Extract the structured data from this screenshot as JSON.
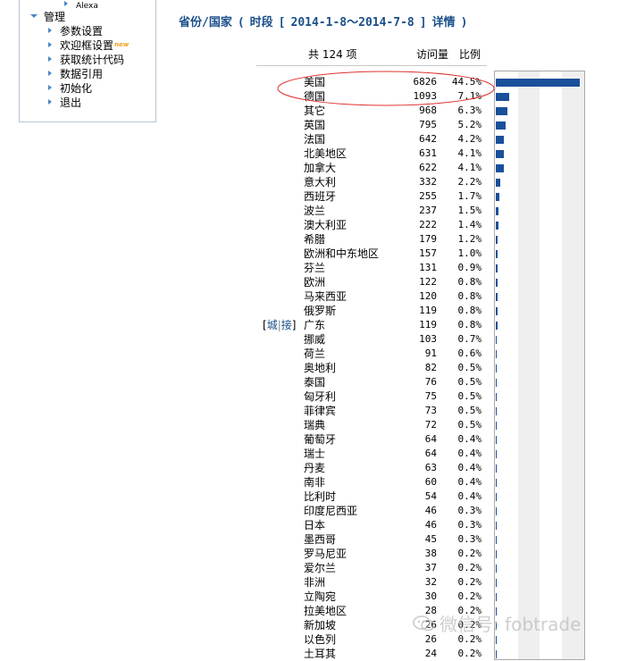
{
  "sidebar": {
    "items": [
      {
        "label": "Alexa",
        "icon": "arrow-right-icon"
      },
      {
        "label": "管理",
        "icon": "arrow-down-icon"
      },
      {
        "label": "参数设置",
        "icon": "arrow-right-icon"
      },
      {
        "label": "欢迎框设置",
        "icon": "arrow-right-icon",
        "badge": "new"
      },
      {
        "label": "获取统计代码",
        "icon": "arrow-right-icon"
      },
      {
        "label": "数据引用",
        "icon": "arrow-right-icon"
      },
      {
        "label": "初始化",
        "icon": "arrow-right-icon"
      },
      {
        "label": "退出",
        "icon": "arrow-right-icon"
      }
    ]
  },
  "title": {
    "prefix": "省份/国家",
    "open_paren": "(",
    "period_label": "时段",
    "open_bracket": "[",
    "date_range": "2014-1-8～2014-7-8",
    "close_bracket": "]",
    "details_link": "详情",
    "close_paren": ")"
  },
  "table": {
    "header": {
      "total": "共 124 项",
      "visits": "访问量",
      "ratio": "比例"
    },
    "city_link": "城",
    "separator": "|",
    "isp_link": "接",
    "rows": [
      {
        "name": "美国",
        "visits": "6826",
        "pct": "44.5%"
      },
      {
        "name": "德国",
        "visits": "1093",
        "pct": "7.1%"
      },
      {
        "name": "其它",
        "visits": "968",
        "pct": "6.3%"
      },
      {
        "name": "英国",
        "visits": "795",
        "pct": "5.2%"
      },
      {
        "name": "法国",
        "visits": "642",
        "pct": "4.2%"
      },
      {
        "name": "北美地区",
        "visits": "631",
        "pct": "4.1%"
      },
      {
        "name": "加拿大",
        "visits": "622",
        "pct": "4.1%"
      },
      {
        "name": "意大利",
        "visits": "332",
        "pct": "2.2%"
      },
      {
        "name": "西班牙",
        "visits": "255",
        "pct": "1.7%"
      },
      {
        "name": "波兰",
        "visits": "237",
        "pct": "1.5%"
      },
      {
        "name": "澳大利亚",
        "visits": "222",
        "pct": "1.4%"
      },
      {
        "name": "希腊",
        "visits": "179",
        "pct": "1.2%"
      },
      {
        "name": "欧洲和中东地区",
        "visits": "157",
        "pct": "1.0%"
      },
      {
        "name": "芬兰",
        "visits": "131",
        "pct": "0.9%"
      },
      {
        "name": "欧洲",
        "visits": "122",
        "pct": "0.8%"
      },
      {
        "name": "马来西亚",
        "visits": "120",
        "pct": "0.8%"
      },
      {
        "name": "俄罗斯",
        "visits": "119",
        "pct": "0.8%"
      },
      {
        "name": "广东",
        "visits": "119",
        "pct": "0.8%"
      },
      {
        "name": "挪威",
        "visits": "103",
        "pct": "0.7%"
      },
      {
        "name": "荷兰",
        "visits": "91",
        "pct": "0.6%"
      },
      {
        "name": "奥地利",
        "visits": "82",
        "pct": "0.5%"
      },
      {
        "name": "泰国",
        "visits": "76",
        "pct": "0.5%"
      },
      {
        "name": "匈牙利",
        "visits": "75",
        "pct": "0.5%"
      },
      {
        "name": "菲律宾",
        "visits": "73",
        "pct": "0.5%"
      },
      {
        "name": "瑞典",
        "visits": "72",
        "pct": "0.5%"
      },
      {
        "name": "葡萄牙",
        "visits": "64",
        "pct": "0.4%"
      },
      {
        "name": "瑞士",
        "visits": "64",
        "pct": "0.4%"
      },
      {
        "name": "丹麦",
        "visits": "63",
        "pct": "0.4%"
      },
      {
        "name": "南非",
        "visits": "60",
        "pct": "0.4%"
      },
      {
        "name": "比利时",
        "visits": "54",
        "pct": "0.4%"
      },
      {
        "name": "印度尼西亚",
        "visits": "46",
        "pct": "0.3%"
      },
      {
        "name": "日本",
        "visits": "46",
        "pct": "0.3%"
      },
      {
        "name": "墨西哥",
        "visits": "45",
        "pct": "0.3%"
      },
      {
        "name": "罗马尼亚",
        "visits": "38",
        "pct": "0.2%"
      },
      {
        "name": "爱尔兰",
        "visits": "37",
        "pct": "0.2%"
      },
      {
        "name": "非洲",
        "visits": "32",
        "pct": "0.2%"
      },
      {
        "name": "立陶宛",
        "visits": "30",
        "pct": "0.2%"
      },
      {
        "name": "拉美地区",
        "visits": "28",
        "pct": "0.2%"
      },
      {
        "name": "新加坡",
        "visits": "26",
        "pct": "0.2%"
      },
      {
        "name": "以色列",
        "visits": "26",
        "pct": "0.2%"
      },
      {
        "name": "土耳其",
        "visits": "24",
        "pct": "0.2%"
      }
    ]
  },
  "chart_data": {
    "type": "bar",
    "max_value": 6826,
    "bar_color": "#1a4f9a"
  },
  "annotation": {
    "color": "#e03030"
  },
  "watermark": {
    "text": "微信号: fobtrade",
    "icon": "wechat-icon"
  },
  "colors": {
    "title": "#1a4f8a",
    "menu_arrow": "#4a86c5",
    "badge": "#f0a020"
  }
}
